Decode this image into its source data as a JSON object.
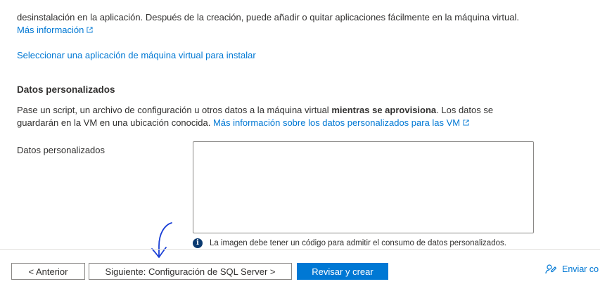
{
  "apps": {
    "intro_text": "desinstalación en la aplicación. Después de la creación, puede añadir o quitar aplicaciones fácilmente en la máquina virtual.",
    "more_info_link": "Más información",
    "select_app_link": "Seleccionar una aplicación de máquina virtual para instalar"
  },
  "custom_data": {
    "section_title": "Datos personalizados",
    "desc_before": "Pase un script, un archivo de configuración u otros datos a la máquina virtual ",
    "desc_bold": "mientras se aprovisiona",
    "desc_after": ". Los datos se guardarán en la VM en una ubicación conocida. ",
    "desc_link": "Más información sobre los datos personalizados para las VM",
    "field_label": "Datos personalizados",
    "field_value": "",
    "info_text": "La imagen debe tener un código para admitir el consumo de datos personalizados."
  },
  "footer": {
    "previous_label": "< Anterior",
    "next_label": "Siguiente: Configuración de SQL Server >",
    "review_label": "Revisar y crear",
    "feedback_label": "Enviar co"
  },
  "colors": {
    "link": "#0078d4",
    "primary_button": "#0078d4",
    "annotation_pen": "#1a3fd6"
  },
  "icons": {
    "external_link": "external-link-icon",
    "info": "info-icon",
    "feedback": "feedback-icon"
  }
}
